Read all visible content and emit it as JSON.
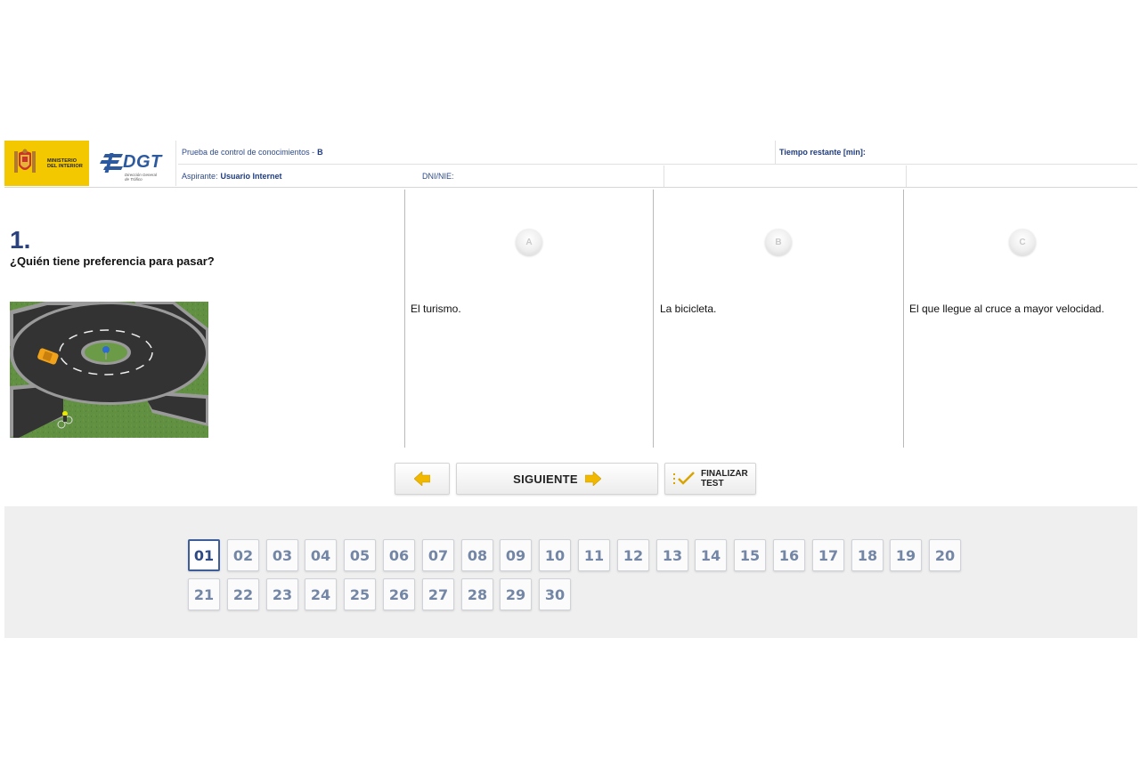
{
  "header": {
    "ministry_text": "MINISTERIO\nDEL INTERIOR",
    "dgt_logo": "DGT",
    "dgt_sub": "Dirección General\nde Tráfico",
    "test_label": "Prueba de control de conocimientos -",
    "test_value": "B",
    "time_label": "Tiempo restante [min]:",
    "candidate_label": "Aspirante:",
    "candidate_value": "Usuario Internet",
    "dni_label": "DNI/NIE:"
  },
  "question": {
    "number": "1.",
    "text": "¿Quién tiene preferencia para pasar?",
    "image_icon": "roundabout-image"
  },
  "answers": [
    {
      "letter": "A",
      "text": "El turismo."
    },
    {
      "letter": "B",
      "text": "La bicicleta."
    },
    {
      "letter": "C",
      "text": "El que llegue al cruce a mayor velocidad."
    }
  ],
  "buttons": {
    "prev_icon": "arrow-left-icon",
    "next_label": "SIGUIENTE",
    "next_icon": "arrow-right-icon",
    "finish_label": "FINALIZAR TEST",
    "finish_icon": "checklist-icon"
  },
  "navigation": {
    "active": "01",
    "items": [
      "01",
      "02",
      "03",
      "04",
      "05",
      "06",
      "07",
      "08",
      "09",
      "10",
      "11",
      "12",
      "13",
      "14",
      "15",
      "16",
      "17",
      "18",
      "19",
      "20",
      "21",
      "22",
      "23",
      "24",
      "25",
      "26",
      "27",
      "28",
      "29",
      "30"
    ]
  },
  "colors": {
    "ministry_yellow": "#f4c800",
    "dgt_blue": "#2d5a9e",
    "question_blue": "#2b4280",
    "nav_text": "#7386a6",
    "arrow_yellow": "#f0b800",
    "panel_gray": "#efefef"
  }
}
